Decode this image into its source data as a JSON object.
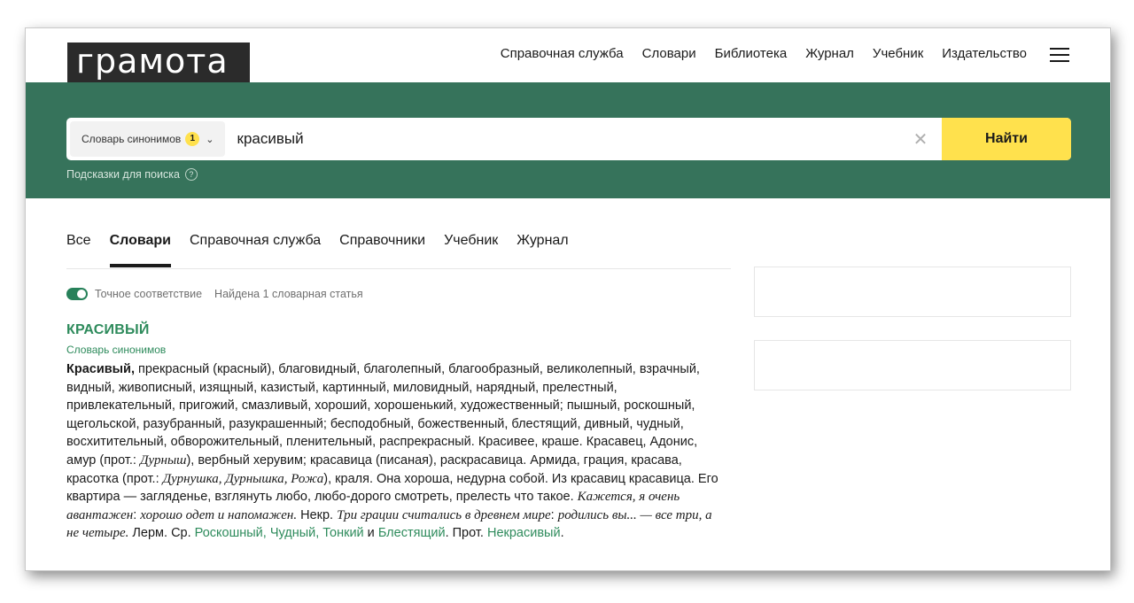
{
  "logo": {
    "text": "грамота"
  },
  "nav": {
    "items": [
      "Справочная служба",
      "Словари",
      "Библиотека",
      "Журнал",
      "Учебник",
      "Издательство"
    ]
  },
  "search": {
    "dict_label": "Словарь синонимов",
    "dict_count": "1",
    "value": "красивый",
    "clear_symbol": "✕",
    "find_label": "Найти",
    "hints_label": "Подсказки для поиска",
    "hints_icon": "?"
  },
  "tabs": [
    {
      "label": "Все",
      "active": false
    },
    {
      "label": "Словари",
      "active": true
    },
    {
      "label": "Справочная служба",
      "active": false
    },
    {
      "label": "Справочники",
      "active": false
    },
    {
      "label": "Учебник",
      "active": false
    },
    {
      "label": "Журнал",
      "active": false
    }
  ],
  "results": {
    "exact_match_label": "Точное соответствие",
    "exact_match_on": true,
    "found_label": "Найдена 1 словарная статья"
  },
  "entry": {
    "title": "КРАСИВЫЙ",
    "source": "Словарь синонимов",
    "body": [
      {
        "t": "b",
        "v": "Красивый,"
      },
      {
        "t": "n",
        "v": " прекрасный (красный), благовидный, благолепный, благообразный, великолепный, взрачный, видный, живописный, изящный, казистый, картинный, миловидный, нарядный, прелестный, привлекательный, пригожий, смазливый, хороший, хорошенький, художественный; пышный, роскошный, щегольской, разубранный, разукрашенный; бесподобный, божественный, блестящий, дивный, чудный, восхитительный, обворожительный, пленительный, распрекрасный. Красивее, краше. Красавец, Адонис, амур (прот.: "
      },
      {
        "t": "i",
        "v": "Дурныш"
      },
      {
        "t": "n",
        "v": "), вербный херувим; красавица (писаная), раскрасавица. Армида, грация, красава, красотка (прот.: "
      },
      {
        "t": "i",
        "v": "Дурнушка, Дурнышка, Рожа"
      },
      {
        "t": "n",
        "v": "), краля. Она хороша, недурна собой. Из красавиц красавица. Его квартира — загляденье, взглянуть любо, любо-дорого смотреть, прелесть что такое. "
      },
      {
        "t": "i",
        "v": "Кажется, я очень авантажен"
      },
      {
        "t": "n",
        "v": ": "
      },
      {
        "t": "i",
        "v": "хорошо одет и напомажен."
      },
      {
        "t": "n",
        "v": " Некр. "
      },
      {
        "t": "i",
        "v": "Три грации считались в древнем мире"
      },
      {
        "t": "n",
        "v": ": "
      },
      {
        "t": "i",
        "v": "родились вы... — все три, а не четыре."
      },
      {
        "t": "n",
        "v": " Лерм. Ср. "
      },
      {
        "t": "a",
        "v": "Роскошный"
      },
      {
        "t": "a",
        "v": ", Чудный"
      },
      {
        "t": "a",
        "v": ", Тонкий"
      },
      {
        "t": "n",
        "v": " и "
      },
      {
        "t": "a",
        "v": "Блестящий"
      },
      {
        "t": "n",
        "v": ". Прот. "
      },
      {
        "t": "a",
        "v": "Некрасивый"
      },
      {
        "t": "n",
        "v": "."
      }
    ]
  },
  "colors": {
    "band": "#36735b",
    "accent_yellow": "#ffe14d",
    "link_green": "#2e8b5c"
  }
}
